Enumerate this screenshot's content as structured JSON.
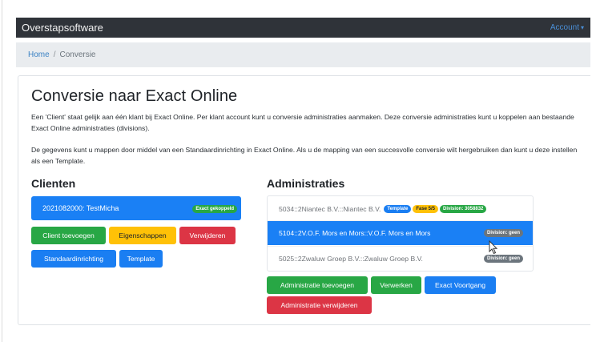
{
  "navbar": {
    "brand": "Overstapsoftware",
    "account": "Account"
  },
  "breadcrumb": {
    "home": "Home",
    "separator": "/",
    "current": "Conversie"
  },
  "page": {
    "title": "Conversie naar Exact Online",
    "paragraph1": "Een 'Client' staat gelijk aan één klant bij Exact Online. Per klant account kunt u conversie administraties aanmaken. Deze conversie administraties kunt u koppelen aan bestaande Exact Online administraties (divisions).",
    "paragraph2": "De gegevens kunt u mappen door middel van een Standaardinrichting in Exact Online. Als u de mapping van een succesvolle conversie wilt hergebruiken dan kunt u deze instellen als een Template."
  },
  "clients": {
    "heading": "Clienten",
    "items": [
      {
        "label": "2021082000: TestMicha",
        "badge": "Exact gekoppeld"
      }
    ],
    "buttons": {
      "add": "Client toevoegen",
      "properties": "Eigenschappen",
      "delete": "Verwijderen",
      "standard": "Standaardinrichting",
      "template": "Template"
    }
  },
  "administrations": {
    "heading": "Administraties",
    "items": [
      {
        "label": "5034::2Niantec B.V.::Niantec B.V.",
        "badges": [
          "Template",
          "Fase 5/5",
          "Division: 3058832"
        ]
      },
      {
        "label": "5104::2V.O.F. Mors en Mors::V.O.F. Mors en Mors",
        "badges": [
          "Division: geen"
        ]
      },
      {
        "label": "5025::2Zwaluw Groep B.V.::Zwaluw Groep B.V.",
        "badges": [
          "Division: geen"
        ]
      }
    ],
    "buttons": {
      "add": "Administratie toevoegen",
      "process": "Verwerken",
      "progress": "Exact Voortgang",
      "delete": "Administratie verwijderen"
    }
  },
  "colors": {
    "primary": "#1a80f5",
    "success": "#28a745",
    "warning": "#ffc107",
    "danger": "#dc3545",
    "secondary": "#6c757d",
    "navbar": "#2f3339"
  }
}
